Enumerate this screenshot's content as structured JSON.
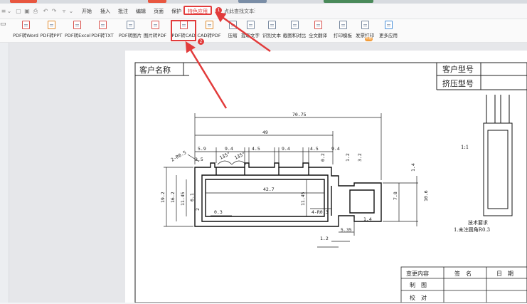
{
  "menu": {
    "items": [
      "开始",
      "插入",
      "批注",
      "编辑",
      "页面",
      "保护"
    ],
    "special": "特色应用",
    "search": "点此查找文本"
  },
  "ribbon": {
    "buttons": [
      "PDF转Word",
      "PDF转PPT",
      "PDF转Excel",
      "PDF转TXT",
      "PDF转图片",
      "图片转PDF",
      "PDF转CAD",
      "CAD转PDF",
      "压缩",
      "提取文字",
      "识别文本",
      "截图和对比",
      "全文翻译",
      "打印模板",
      "发票打印",
      "更多应用"
    ],
    "badge": "特惠"
  },
  "callouts": {
    "one": "1",
    "two": "2"
  },
  "drawing": {
    "title_customer_name": "客户名称",
    "title_customer_model": "客户型号",
    "title_extrusion_model": "挤压型号",
    "scale": "1:1",
    "tech_req_title": "技术要求",
    "tech_req_item": "1.未注圆角R0.3",
    "table_change": "变更内容",
    "table_sign": "签　名",
    "table_date": "日　期",
    "table_draw": "制　图",
    "table_check": "校　对",
    "dims": {
      "overall": "70.75",
      "inner": "49",
      "d59": "5.9",
      "d94a": "9.4",
      "d45a": "4.5",
      "d94b": "9.4",
      "d45b": "4.5",
      "d94c": "9.4",
      "radius_left": "2-R0.5",
      "d35": "3.5",
      "angle_a": "135°",
      "angle_b": "135°",
      "d02": "0.2",
      "d12a": "1.2",
      "d32": "3.2",
      "d14a": "1.4",
      "d427": "42.7",
      "d192": "19.2",
      "d162": "16.2",
      "d1145a": "11.45",
      "d61": "6.1",
      "d2": "2",
      "d03": "0.3",
      "d1145b": "11.45",
      "radius_right": "4-R0.3",
      "d78": "7.8",
      "d106": "10.6",
      "d14b": "1.4",
      "d535": "5.35",
      "d12b": "1.2"
    }
  }
}
